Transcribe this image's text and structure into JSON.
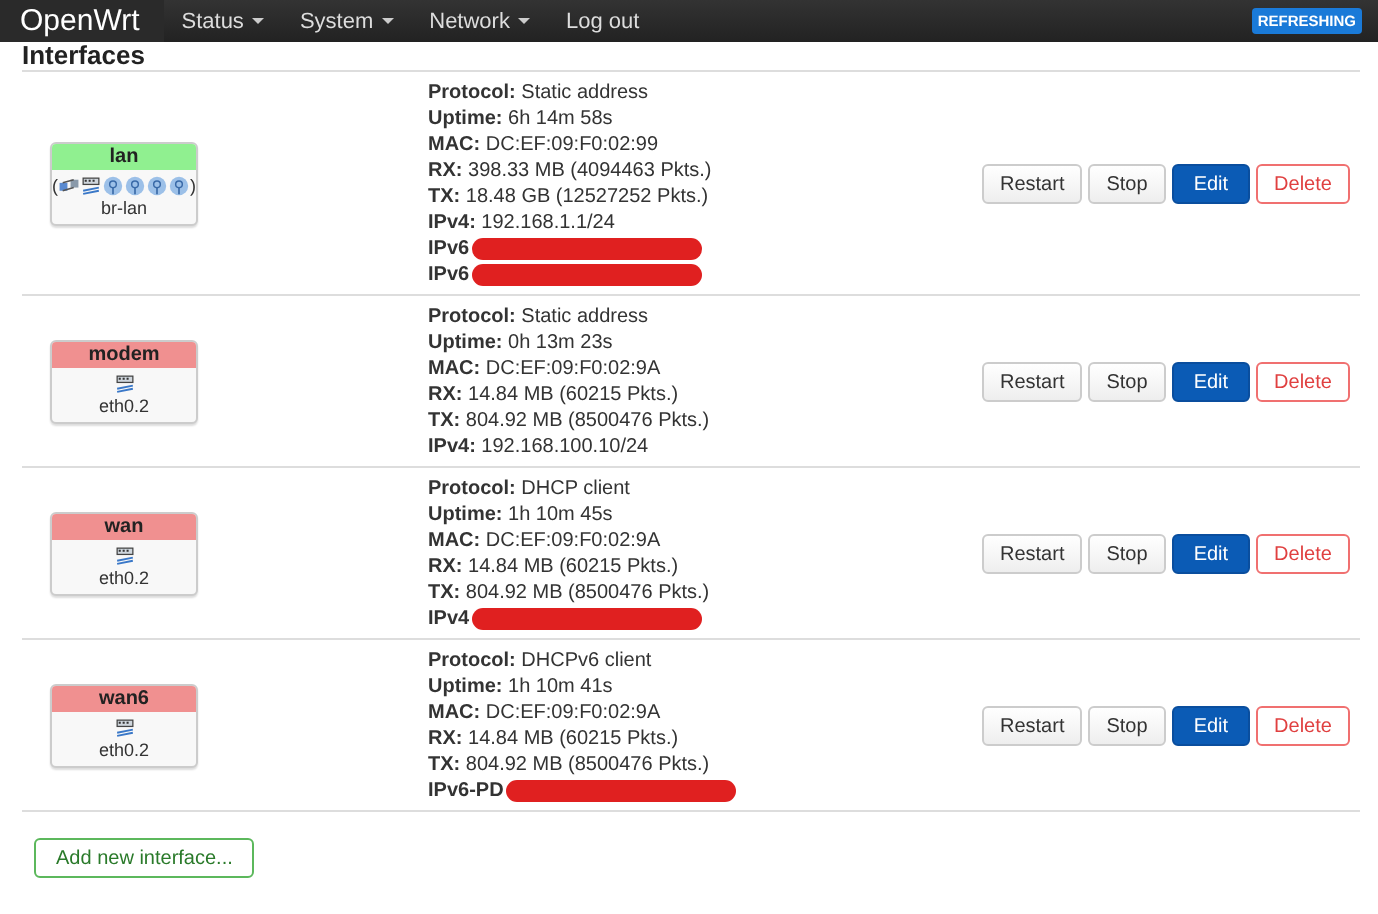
{
  "navbar": {
    "brand": "OpenWrt",
    "menu": [
      {
        "label": "Status",
        "dropdown": true
      },
      {
        "label": "System",
        "dropdown": true
      },
      {
        "label": "Network",
        "dropdown": true
      },
      {
        "label": "Log out",
        "dropdown": false
      }
    ],
    "indicator": "REFRESHING"
  },
  "heading": "Interfaces",
  "interfaces": [
    {
      "name": "lan",
      "color": "#90f090",
      "open": "(",
      "close": ")",
      "devices": [
        {
          "kind": "bridge"
        },
        {
          "kind": "ethernet"
        },
        {
          "kind": "wireless"
        },
        {
          "kind": "wireless"
        },
        {
          "kind": "wireless"
        },
        {
          "kind": "wireless"
        }
      ],
      "device_label": "br-lan",
      "info": [
        {
          "label": "Protocol:",
          "value": "Static address"
        },
        {
          "label": "Uptime:",
          "value": "6h 14m 58s"
        },
        {
          "label": "MAC:",
          "value": "DC:EF:09:F0:02:99"
        },
        {
          "label": "RX:",
          "value": "398.33 MB (4094463 Pkts.)"
        },
        {
          "label": "TX:",
          "value": "18.48 GB (12527252 Pkts.)"
        },
        {
          "label": "IPv4:",
          "value": "192.168.1.1/24"
        },
        {
          "label": "IPv6",
          "redacted": true
        },
        {
          "label": "IPv6",
          "redacted": true
        }
      ],
      "actions": [
        {
          "label": "Restart",
          "kind": "plain"
        },
        {
          "label": "Stop",
          "kind": "plain"
        },
        {
          "label": "Edit",
          "kind": "primary"
        },
        {
          "label": "Delete",
          "kind": "danger"
        }
      ]
    },
    {
      "name": "modem",
      "color": "#f09090",
      "devices": [
        {
          "kind": "ethernet"
        }
      ],
      "device_label": "eth0.2",
      "info": [
        {
          "label": "Protocol:",
          "value": "Static address"
        },
        {
          "label": "Uptime:",
          "value": "0h 13m 23s"
        },
        {
          "label": "MAC:",
          "value": "DC:EF:09:F0:02:9A"
        },
        {
          "label": "RX:",
          "value": "14.84 MB (60215 Pkts.)"
        },
        {
          "label": "TX:",
          "value": "804.92 MB (8500476 Pkts.)"
        },
        {
          "label": "IPv4:",
          "value": "192.168.100.10/24"
        }
      ],
      "actions": [
        {
          "label": "Restart",
          "kind": "plain"
        },
        {
          "label": "Stop",
          "kind": "plain"
        },
        {
          "label": "Edit",
          "kind": "primary"
        },
        {
          "label": "Delete",
          "kind": "danger"
        }
      ]
    },
    {
      "name": "wan",
      "color": "#f09090",
      "devices": [
        {
          "kind": "ethernet"
        }
      ],
      "device_label": "eth0.2",
      "info": [
        {
          "label": "Protocol:",
          "value": "DHCP client"
        },
        {
          "label": "Uptime:",
          "value": "1h 10m 45s"
        },
        {
          "label": "MAC:",
          "value": "DC:EF:09:F0:02:9A"
        },
        {
          "label": "RX:",
          "value": "14.84 MB (60215 Pkts.)"
        },
        {
          "label": "TX:",
          "value": "804.92 MB (8500476 Pkts.)"
        },
        {
          "label": "IPv4",
          "redacted": true
        }
      ],
      "actions": [
        {
          "label": "Restart",
          "kind": "plain"
        },
        {
          "label": "Stop",
          "kind": "plain"
        },
        {
          "label": "Edit",
          "kind": "primary"
        },
        {
          "label": "Delete",
          "kind": "danger"
        }
      ]
    },
    {
      "name": "wan6",
      "color": "#f09090",
      "devices": [
        {
          "kind": "ethernet"
        }
      ],
      "device_label": "eth0.2",
      "info": [
        {
          "label": "Protocol:",
          "value": "DHCPv6 client"
        },
        {
          "label": "Uptime:",
          "value": "1h 10m 41s"
        },
        {
          "label": "MAC:",
          "value": "DC:EF:09:F0:02:9A"
        },
        {
          "label": "RX:",
          "value": "14.84 MB (60215 Pkts.)"
        },
        {
          "label": "TX:",
          "value": "804.92 MB (8500476 Pkts.)"
        },
        {
          "label": "IPv6-PD",
          "redacted": true
        }
      ],
      "actions": [
        {
          "label": "Restart",
          "kind": "plain"
        },
        {
          "label": "Stop",
          "kind": "plain"
        },
        {
          "label": "Edit",
          "kind": "primary"
        },
        {
          "label": "Delete",
          "kind": "danger"
        }
      ]
    }
  ],
  "add_button": "Add new interface..."
}
